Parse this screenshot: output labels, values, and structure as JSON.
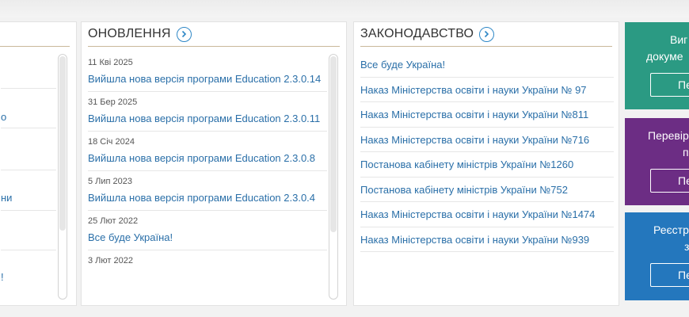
{
  "left_panel": {
    "fragments": [
      "о",
      "ни",
      "!"
    ]
  },
  "updates": {
    "title": "ОНОВЛЕННЯ",
    "items": [
      {
        "date": "11 Кві 2025",
        "text": "Вийшла нова версія програми Education 2.3.0.14"
      },
      {
        "date": "31 Бер 2025",
        "text": "Вийшла нова версія програми Education 2.3.0.11"
      },
      {
        "date": "18 Січ 2024",
        "text": "Вийшла нова версія програми Education 2.3.0.8"
      },
      {
        "date": "5 Лип 2023",
        "text": "Вийшла нова версія програми Education 2.3.0.4"
      },
      {
        "date": "25 Лют 2022",
        "text": "Все буде Україна!"
      },
      {
        "date": "3 Лют 2022",
        "text": ""
      }
    ]
  },
  "legislation": {
    "title": "ЗАКОНОДАВСТВО",
    "items": [
      "Все буде Україна!",
      "Наказ Міністерства освіти і науки України № 97",
      "Наказ Міністерства освіти і науки України №811",
      "Наказ Міністерства освіти і науки України №716",
      "Постанова кабінету міністрів України №1260",
      "Постанова кабінету міністрів України №752",
      "Наказ Міністерства освіти і науки України №1474",
      "Наказ Міністерства освіти і науки України №939"
    ]
  },
  "cards": [
    {
      "line1": "Виг",
      "line2": "докуме",
      "button": "Пе",
      "color": "#2b9a83"
    },
    {
      "line1": "Перевір",
      "line2": "пр",
      "button": "Пе",
      "color": "#6c2d84"
    },
    {
      "line1": "Реєстр",
      "line2": "з",
      "button": "Пе",
      "color": "#2477bd"
    }
  ],
  "colors": {
    "link": "#2a6fa8",
    "accent": "#2e87c6",
    "divider": "#c9b89a"
  },
  "icons": {
    "more": "chevron-right-circle-icon"
  }
}
